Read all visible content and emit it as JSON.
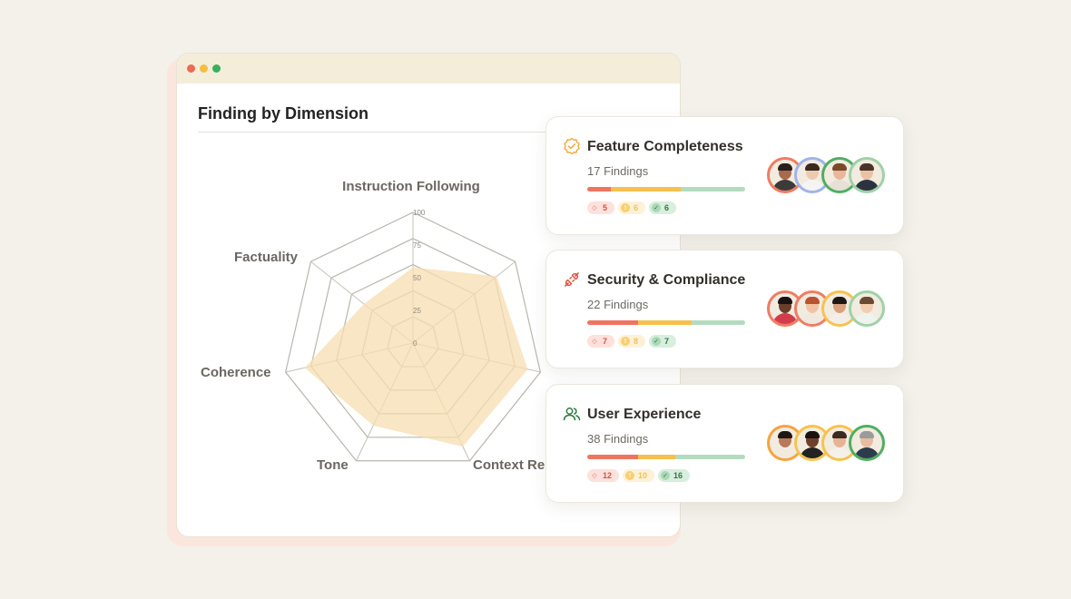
{
  "panel": {
    "title": "Finding by Dimension",
    "window_dots": [
      "#ee6a55",
      "#f6bd3f",
      "#3ab05a"
    ]
  },
  "chart_data": {
    "type": "radar",
    "title": "",
    "axes": [
      "Instruction Following",
      "Context Re",
      "Tone",
      "Coherence",
      "Factuality"
    ],
    "axis_labels_visible": [
      "Instruction Following",
      "Context Re",
      "Tone",
      "Coherence",
      "Factuality"
    ],
    "ticks": [
      "0",
      "25",
      "50",
      "75",
      "100"
    ],
    "range": [
      0,
      100
    ],
    "grid": true,
    "series": [
      {
        "values": [
          58,
          82,
          90,
          88,
          70,
          85,
          48
        ],
        "color": "#f7ddb0"
      }
    ]
  },
  "cards": [
    {
      "title": "Feature Completeness",
      "count": "17 Findings",
      "icon": "verified-badge-icon",
      "icon_color": "#f2a93b",
      "bar": [
        0.15,
        0.44,
        0.41
      ],
      "chips": {
        "red": "5",
        "yellow": "6",
        "green": "6"
      },
      "avatars": [
        {
          "ring": "#ef7d63",
          "skin": "#a86a4a",
          "hair": "#2a1f1a",
          "shirt": "#3d3a3a"
        },
        {
          "ring": "#9fb4e8",
          "skin": "#efc9ae",
          "hair": "#3a2a20",
          "shirt": "#f4f4f4"
        },
        {
          "ring": "#4fae62",
          "skin": "#e8b79a",
          "hair": "#7a4a2a",
          "shirt": "#e6e0d6"
        },
        {
          "ring": "#9fd2a8",
          "skin": "#e9c2a6",
          "hair": "#4a3428",
          "shirt": "#2c3340"
        }
      ]
    },
    {
      "title": "Security & Compliance",
      "count": "22 Findings",
      "icon": "plug-icon",
      "icon_color": "#e0543d",
      "bar": [
        0.32,
        0.34,
        0.34
      ],
      "chips": {
        "red": "7",
        "yellow": "8",
        "green": "7"
      },
      "avatars": [
        {
          "ring": "#ef7d63",
          "skin": "#6b3d2a",
          "hair": "#1a1210",
          "shirt": "#d33c4b"
        },
        {
          "ring": "#ef7d63",
          "skin": "#f0c4a2",
          "hair": "#b8532f",
          "shirt": "#efe9df"
        },
        {
          "ring": "#f6c34f",
          "skin": "#d9a07d",
          "hair": "#1f1714",
          "shirt": "#f3efe8"
        },
        {
          "ring": "#9fd2a8",
          "skin": "#f2cdb2",
          "hair": "#6a4a30",
          "shirt": "#eef3ee"
        }
      ]
    },
    {
      "title": "User Experience",
      "count": "38 Findings",
      "icon": "users-icon",
      "icon_color": "#2f7a43",
      "bar": [
        0.32,
        0.24,
        0.44
      ],
      "chips": {
        "red": "12",
        "yellow": "10",
        "green": "16"
      },
      "avatars": [
        {
          "ring": "#f6a33f",
          "skin": "#b9785a",
          "hair": "#1f1714",
          "shirt": "#f0eadf"
        },
        {
          "ring": "#f6c34f",
          "skin": "#6e402c",
          "hair": "#1a1210",
          "shirt": "#222222"
        },
        {
          "ring": "#f6c34f",
          "skin": "#e6b394",
          "hair": "#3b2a22",
          "shirt": "#f4f1ec"
        },
        {
          "ring": "#4fae62",
          "skin": "#e7bca0",
          "hair": "#9b9b9b",
          "shirt": "#2e3b4a"
        }
      ]
    }
  ],
  "colors": {
    "bar_red": "#ef7560",
    "bar_yellow": "#f6c04f",
    "bar_green": "#b3dcbf"
  }
}
